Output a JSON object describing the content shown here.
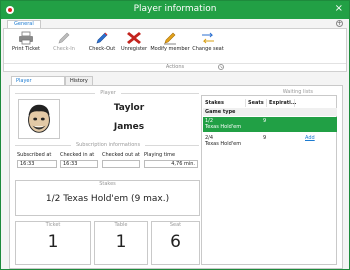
{
  "window": {
    "title": "Player information",
    "close": "×"
  },
  "ribbon": {
    "tab": "General",
    "buttons": [
      {
        "label": "Print Ticket"
      },
      {
        "label": "Check-In"
      },
      {
        "label": "Check-Out"
      },
      {
        "label": "Unregister"
      },
      {
        "label": "Modify member"
      },
      {
        "label": "Change seat"
      }
    ],
    "group_label": "Actions"
  },
  "tabs": [
    "Player information",
    "History"
  ],
  "player": {
    "section": "Player",
    "first_name": "Taylor",
    "last_name": "James"
  },
  "subscription": {
    "section": "Subscription informations",
    "fields": [
      {
        "label": "Subscribed at",
        "value": "16:33"
      },
      {
        "label": "Checked in at",
        "value": "16:33"
      },
      {
        "label": "Checked out at",
        "value": ""
      },
      {
        "label": "Playing time",
        "value": "4,76 min."
      }
    ]
  },
  "stakes": {
    "label": "Stakes",
    "value": "1/2 Texas Hold'em (9 max.)"
  },
  "seat_info": {
    "ticket": {
      "label": "Ticket",
      "value": "1"
    },
    "table": {
      "label": "Table",
      "value": "1"
    },
    "seat": {
      "label": "Seat",
      "value": "6"
    }
  },
  "waiting_lists": {
    "title": "Waiting lists",
    "columns": [
      "Stakes",
      "Seats",
      "Expirati..."
    ],
    "group": "Game type",
    "rows": [
      {
        "stakes": "1/2",
        "game": "Texas Hold'em",
        "seats": "9",
        "expiration": "",
        "action": ""
      },
      {
        "stakes": "2/4",
        "game": "Texas Hold'em",
        "seats": "9",
        "expiration": "",
        "action": "Add"
      }
    ]
  },
  "colors": {
    "accent": "#22a045",
    "link": "#1c7bd1"
  }
}
